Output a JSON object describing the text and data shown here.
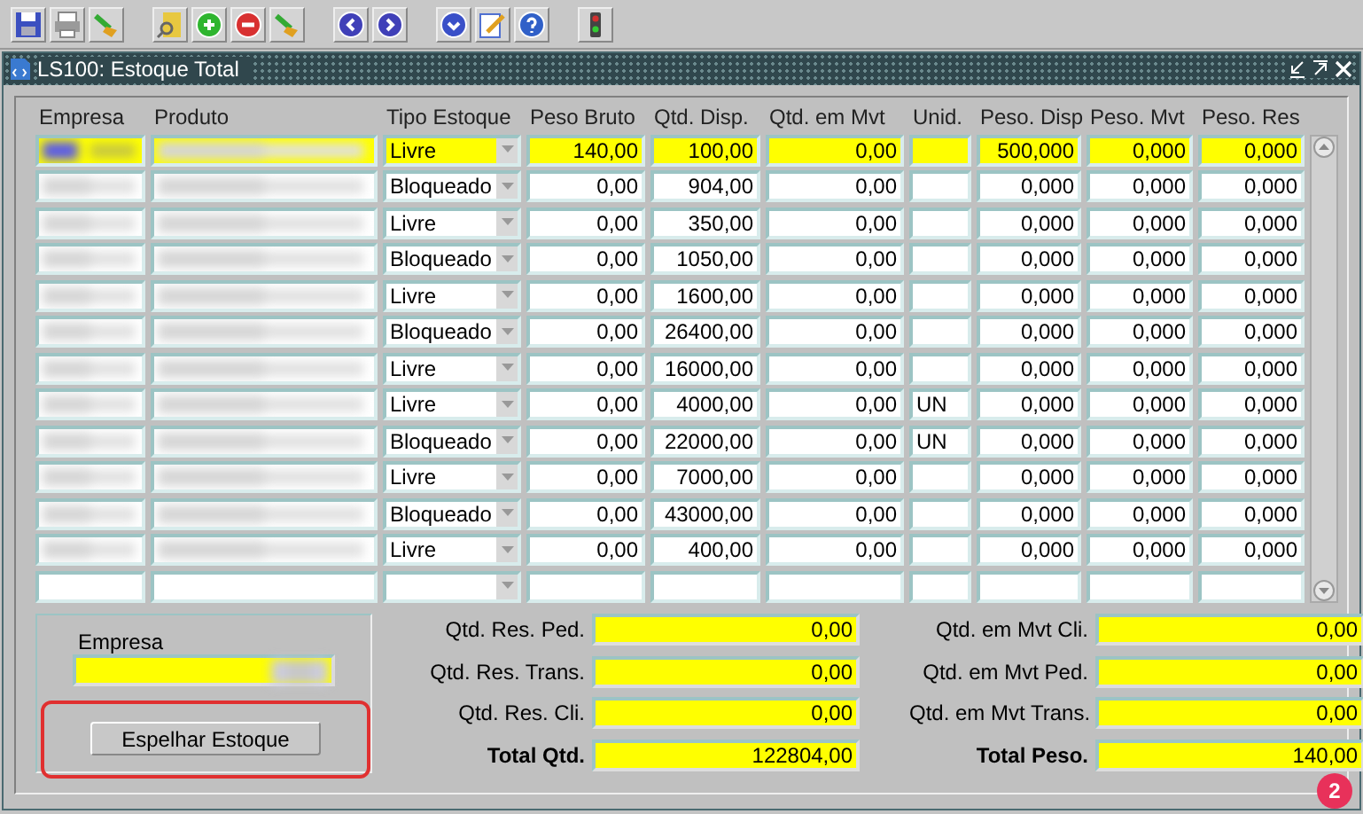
{
  "window": {
    "title": "LS100: Estoque Total"
  },
  "table": {
    "columns": [
      "Empresa",
      "Produto",
      "Tipo Estoque",
      "Peso Bruto",
      "Qtd. Disp.",
      "Qtd. em Mvt",
      "Unid.",
      "Peso. Disp",
      "Peso. Mvt",
      "Peso. Res"
    ],
    "rows": [
      {
        "selected": true,
        "blurred": true,
        "tipo": "Livre",
        "peso_bruto": "140,00",
        "qtd_disp": "100,00",
        "qtd_mvt": "0,00",
        "peso_disp": "500,000",
        "peso_mvt": "0,000",
        "peso_res": "0,000"
      },
      {
        "selected": false,
        "blurred": true,
        "tipo": "Bloqueado",
        "peso_bruto": "0,00",
        "qtd_disp": "904,00",
        "qtd_mvt": "0,00",
        "peso_disp": "0,000",
        "peso_mvt": "0,000",
        "peso_res": "0,000"
      },
      {
        "selected": false,
        "blurred": true,
        "tipo": "Livre",
        "peso_bruto": "0,00",
        "qtd_disp": "350,00",
        "qtd_mvt": "0,00",
        "peso_disp": "0,000",
        "peso_mvt": "0,000",
        "peso_res": "0,000"
      },
      {
        "selected": false,
        "blurred": true,
        "tipo": "Bloqueado",
        "peso_bruto": "0,00",
        "qtd_disp": "1050,00",
        "qtd_mvt": "0,00",
        "peso_disp": "0,000",
        "peso_mvt": "0,000",
        "peso_res": "0,000"
      },
      {
        "selected": false,
        "blurred": true,
        "tipo": "Livre",
        "peso_bruto": "0,00",
        "qtd_disp": "1600,00",
        "qtd_mvt": "0,00",
        "peso_disp": "0,000",
        "peso_mvt": "0,000",
        "peso_res": "0,000"
      },
      {
        "selected": false,
        "blurred": true,
        "tipo": "Bloqueado",
        "peso_bruto": "0,00",
        "qtd_disp": "26400,00",
        "qtd_mvt": "0,00",
        "peso_disp": "0,000",
        "peso_mvt": "0,000",
        "peso_res": "0,000"
      },
      {
        "selected": false,
        "blurred": true,
        "tipo": "Livre",
        "peso_bruto": "0,00",
        "qtd_disp": "16000,00",
        "qtd_mvt": "0,00",
        "peso_disp": "0,000",
        "peso_mvt": "0,000",
        "peso_res": "0,000"
      },
      {
        "selected": false,
        "blurred": true,
        "tipo": "Livre",
        "peso_bruto": "0,00",
        "qtd_disp": "4000,00",
        "qtd_mvt": "0,00",
        "unid": "UN",
        "peso_disp": "0,000",
        "peso_mvt": "0,000",
        "peso_res": "0,000"
      },
      {
        "selected": false,
        "blurred": true,
        "tipo": "Bloqueado",
        "peso_bruto": "0,00",
        "qtd_disp": "22000,00",
        "qtd_mvt": "0,00",
        "unid": "UN",
        "peso_disp": "0,000",
        "peso_mvt": "0,000",
        "peso_res": "0,000"
      },
      {
        "selected": false,
        "blurred": true,
        "tipo": "Livre",
        "peso_bruto": "0,00",
        "qtd_disp": "7000,00",
        "qtd_mvt": "0,00",
        "peso_disp": "0,000",
        "peso_mvt": "0,000",
        "peso_res": "0,000"
      },
      {
        "selected": false,
        "blurred": true,
        "tipo": "Bloqueado",
        "peso_bruto": "0,00",
        "qtd_disp": "43000,00",
        "qtd_mvt": "0,00",
        "peso_disp": "0,000",
        "peso_mvt": "0,000",
        "peso_res": "0,000"
      },
      {
        "selected": false,
        "blurred": true,
        "tipo": "Livre",
        "peso_bruto": "0,00",
        "qtd_disp": "400,00",
        "qtd_mvt": "0,00",
        "peso_disp": "0,000",
        "peso_mvt": "0,000",
        "peso_res": "0,000"
      }
    ]
  },
  "filter": {
    "label": "Empresa",
    "button": "Espelhar Estoque",
    "highlighted": true
  },
  "totals_left": [
    {
      "label": "Qtd. Res. Ped.",
      "value": "0,00",
      "bold": false
    },
    {
      "label": "Qtd. Res. Trans.",
      "value": "0,00",
      "bold": false
    },
    {
      "label": "Qtd. Res. Cli.",
      "value": "0,00",
      "bold": false
    },
    {
      "label": "Total Qtd.",
      "value": "122804,00",
      "bold": true
    }
  ],
  "totals_right": [
    {
      "label": "Qtd. em Mvt Cli.",
      "value": "0,00",
      "bold": false
    },
    {
      "label": "Qtd. em Mvt Ped.",
      "value": "0,00",
      "bold": false
    },
    {
      "label": "Qtd. em Mvt Trans.",
      "value": "0,00",
      "bold": false
    },
    {
      "label": "Total Peso.",
      "value": "140,00",
      "bold": true
    }
  ],
  "annotation_badge": "2"
}
